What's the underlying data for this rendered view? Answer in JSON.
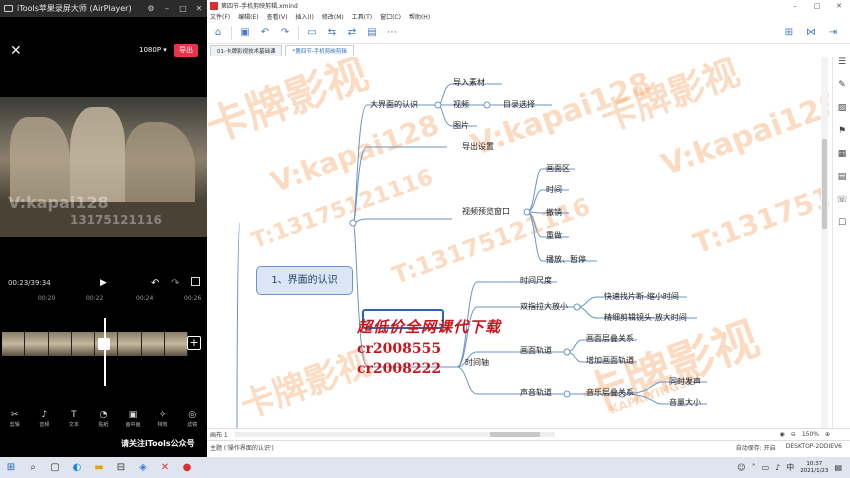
{
  "airplayer": {
    "title": "iTools苹果录屏大师 (AirPlayer)",
    "resolution": "1080P ▾",
    "export_label": "导出",
    "timecode": "00:23/39:34",
    "ruler": [
      "00:20",
      "00:22",
      "00:24",
      "00:26"
    ],
    "watermarks": [
      "V:kapai128",
      "13175121116"
    ],
    "tools": [
      {
        "icon": "✂",
        "label": "剪辑"
      },
      {
        "icon": "♪",
        "label": "音频"
      },
      {
        "icon": "T",
        "label": "文本"
      },
      {
        "icon": "◔",
        "label": "贴纸"
      },
      {
        "icon": "▣",
        "label": "画中画"
      },
      {
        "icon": "✧",
        "label": "特效"
      },
      {
        "icon": "◎",
        "label": "滤镜"
      }
    ],
    "follow_text": "请关注iTools公众号"
  },
  "xmind": {
    "title": "第四节-手机剪映剪辑.xmind",
    "menus": [
      "文件(F)",
      "编辑(E)",
      "查看(V)",
      "插入(I)",
      "修改(M)",
      "工具(T)",
      "窗口(C)",
      "帮助(H)"
    ],
    "tabs": [
      "01-卡牌影视技术基础课",
      "*第四节-手机剪映剪辑"
    ],
    "central": "1、界面的认识",
    "nodes": {
      "b1": "大界面的认识",
      "b1_1": "导入素材",
      "b1_2": "视频",
      "b1_2_1": "目录选择",
      "b1_3": "图片",
      "b2": "导出设置",
      "b3": "视频预览窗口",
      "b3_1": "画面区",
      "b3_2": "时间",
      "b3_3": "撤销",
      "b3_4": "重做",
      "b3_5": "播放、暂停",
      "b4_1": "时间尺度",
      "b4_2": "双指拉大放小",
      "b4_2_1": "快速找片断-缩小时间",
      "b4_2_2": "精细剪辑镜头-放大时间",
      "b4": "时间轴",
      "b4_3": "画面轨道",
      "b4_3_1": "画面层叠关系",
      "b4_3_2": "增加画面轨道",
      "b4_4": "声音轨道",
      "b4_4_1": "音乐层叠关系",
      "b4_4_1_1": "同时发声",
      "b4_4_1_2": "音量大小"
    },
    "overlay": {
      "line1": "超低价全网课代下载",
      "line2": "cr2008555",
      "line3": "cr2008222"
    },
    "watermarks": [
      "卡牌影视",
      "V:kapai128",
      "T:13175121116",
      "KAPAIYINGSHI"
    ],
    "footer_left": "画布 1",
    "zoom": "150%",
    "status_left": "主题 ('操作界面的认识')",
    "status_right": [
      "自动保存: 开启",
      "DESKTOP-2DDIEV6"
    ]
  },
  "taskbar": {
    "time": "10:37",
    "date": "2021/1/23",
    "lang": "中"
  }
}
